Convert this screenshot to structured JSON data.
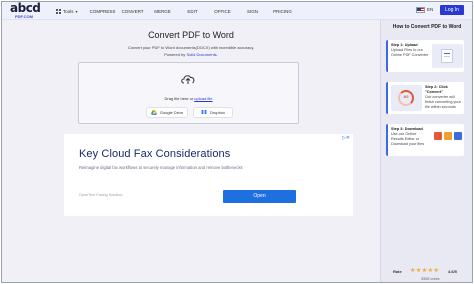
{
  "header": {
    "logo_main": "abcd",
    "logo_sub": "PDF.COM",
    "tools_label": "Tools",
    "nav_items": [
      "COMPRESS",
      "CONVERT",
      "MERGE",
      "EDIT",
      "OFFICE",
      "SIGN",
      "PRICING"
    ],
    "language": "EN",
    "login_label": "Log In"
  },
  "main": {
    "title": "Convert PDF to Word",
    "subtitle": "Convert your PDF to Word documents(DOCX) with incredible accuracy.",
    "powered_prefix": "Powered by",
    "powered_brand": "Solid Documents.",
    "drag_text": "Drag file here or",
    "upload_link": "upload file",
    "google_drive_label": "Google Drive",
    "dropbox_label": "Dropbox"
  },
  "ad": {
    "badge": "▷✕",
    "headline": "Key Cloud Fax Considerations",
    "description": "Reimagine digital fax workflows to securely manage information and remove bottlenecks",
    "brand": "OpenText Faxing Solution",
    "cta_label": "Open"
  },
  "sidebar": {
    "title": "How to Convert PDF to Word",
    "steps": [
      {
        "heading": "Step 1: Upload",
        "body": "Upload Files to our Online PDF Converter"
      },
      {
        "heading": "Step 2: Click \"Convert\"",
        "body": "Our converter will finish converting your file within seconds",
        "ring_label": "8/0"
      },
      {
        "heading": "Step 3: Download",
        "body": "Use our Online Results Editor or Download your files"
      }
    ],
    "rate_label": "Rate",
    "stars": "★★★★★",
    "rating": "4.6/5",
    "votes": "3965 votes"
  },
  "colors": {
    "accent": "#2a3ad1",
    "cta": "#1e6fe0",
    "headline": "#1a2a6c",
    "star": "#f5a623"
  }
}
